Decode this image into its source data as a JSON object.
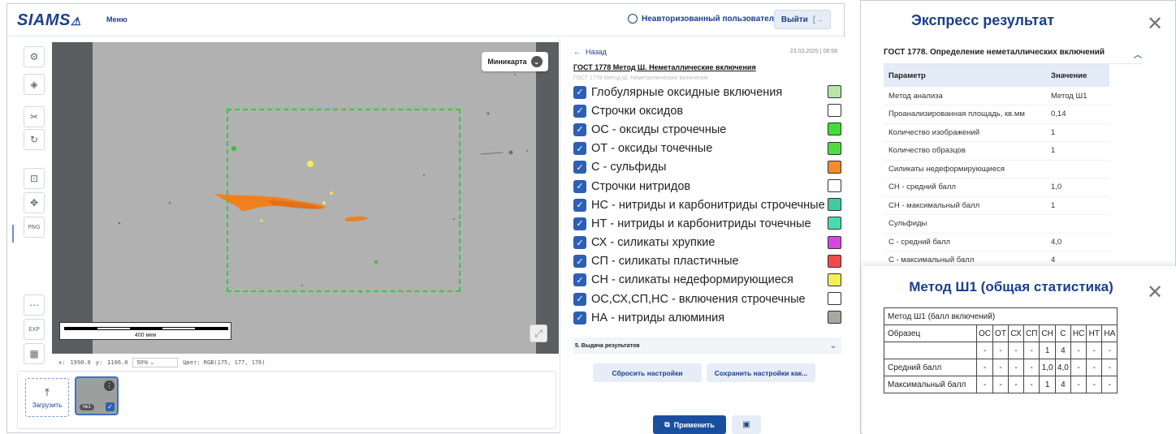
{
  "header": {
    "logo": "SIAMS",
    "menu_label": "Меню",
    "user_label": "Неавторизованный пользователь",
    "logout_label": "Выйти"
  },
  "toolbar": {
    "png_label": "PNG",
    "exp_label": "EXP"
  },
  "viewer": {
    "minimap_label": "Миникарта",
    "scale_label": "400 мкм",
    "status": {
      "x_label": "x:",
      "x_value": "1990.0",
      "y_label": "y:",
      "y_value": "1106.0",
      "zoom": "50%",
      "color_label": "Цвет: RGB(175, 177, 176)"
    }
  },
  "thumbnails": {
    "upload_label": "Загрузить",
    "items": [
      {
        "number": "№1",
        "checked": true
      }
    ]
  },
  "right_panel": {
    "back_label": "Назад",
    "date": "23.03.2025 | 08:58",
    "method_title": "ГОСТ 1778 Метод Ш. Неметаллические включения",
    "method_subtitle": "ГОСТ 1778 Метод Ш. Неметаллические включения",
    "inclusions": [
      {
        "label": "Глобулярные оксидные включения",
        "color": "#b8e6a8",
        "checked": true
      },
      {
        "label": "Строчки оксидов",
        "color": "#ffffff",
        "checked": true
      },
      {
        "label": "ОС - оксиды строчечные",
        "color": "#44dd33",
        "checked": true
      },
      {
        "label": "ОТ - оксиды точечные",
        "color": "#55d844",
        "checked": true
      },
      {
        "label": "С - сульфиды",
        "color": "#f28a2e",
        "checked": true
      },
      {
        "label": "Строчки нитридов",
        "color": "#ffffff",
        "checked": true
      },
      {
        "label": "НС - нитриды и карбонитриды строчечные",
        "color": "#42c9a0",
        "checked": true
      },
      {
        "label": "НТ - нитриды и карбонитриды точечные",
        "color": "#4ad9b0",
        "checked": true
      },
      {
        "label": "СХ - силикаты хрупкие",
        "color": "#d548e0",
        "checked": true
      },
      {
        "label": "СП - силикаты пластичные",
        "color": "#ef4b4b",
        "checked": true
      },
      {
        "label": "СН - силикаты недеформирующиеся",
        "color": "#f2ef5a",
        "checked": true
      },
      {
        "label": "ОС,СХ,СП,НС - включения строчечные",
        "color": "#ffffff",
        "checked": true
      },
      {
        "label": "НА - нитриды алюминия",
        "color": "#a7a89f",
        "checked": true
      }
    ],
    "results_section": "5. Выдача результатов",
    "reset_label": "Сбросить настройки",
    "save_label": "Сохранить настройки как...",
    "apply_label": "Применить"
  },
  "express": {
    "title": "Экспресс результат",
    "section": "ГОСТ 1778. Определение неметаллических включений",
    "col_param": "Параметр",
    "col_value": "Значение",
    "rows": [
      [
        "Метод анализа",
        "Метод Ш1"
      ],
      [
        "Проанализированная площадь, кв.мм",
        "0,14"
      ],
      [
        "Количество изображений",
        "1"
      ],
      [
        "Количество образцов",
        "1"
      ],
      [
        "Силикаты недеформирующиеся",
        ""
      ],
      [
        "СН - средний балл",
        "1,0"
      ],
      [
        "СН - максимальный балл",
        "1"
      ],
      [
        "Сульфиды",
        ""
      ],
      [
        "С - средний балл",
        "4,0"
      ],
      [
        "С - максимальный балл",
        "4"
      ]
    ]
  },
  "stats": {
    "title": "Метод Ш1 (общая статистика)",
    "table_caption": "Метод Ш1 (балл включений)",
    "sample_label": "Образец",
    "columns": [
      "ОС",
      "ОТ",
      "СХ",
      "СП",
      "СН",
      "С",
      "НС",
      "НТ",
      "НА"
    ],
    "rows": [
      {
        "label": "",
        "values": [
          "-",
          "-",
          "-",
          "-",
          "1",
          "4",
          "-",
          "-",
          "-"
        ]
      },
      {
        "label": "Средний балл",
        "values": [
          "-",
          "-",
          "-",
          "-",
          "1,0",
          "4,0",
          "-",
          "-",
          "-"
        ]
      },
      {
        "label": "Максимальный балл",
        "values": [
          "-",
          "-",
          "-",
          "-",
          "1",
          "4",
          "-",
          "-",
          "-"
        ]
      }
    ]
  }
}
